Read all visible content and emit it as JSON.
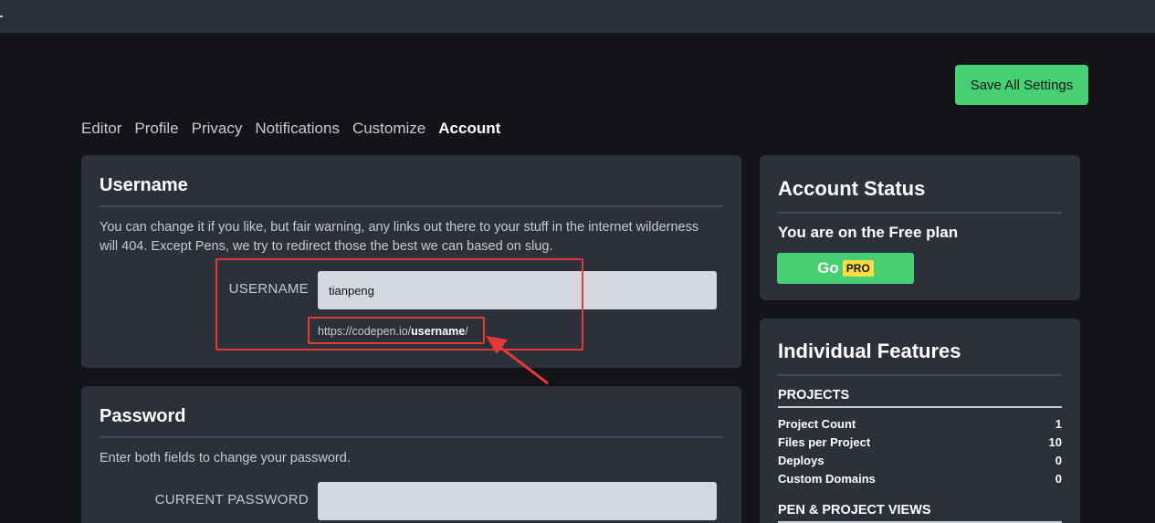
{
  "save_label": "Save All Settings",
  "tabs": [
    {
      "label": "Editor"
    },
    {
      "label": "Profile"
    },
    {
      "label": "Privacy"
    },
    {
      "label": "Notifications"
    },
    {
      "label": "Customize"
    },
    {
      "label": "Account",
      "active": true
    }
  ],
  "username_card": {
    "title": "Username",
    "description": "You can change it if you like, but fair warning, any links out there to your stuff in the internet wilderness will 404. Except Pens, we try to redirect those the best we can based on slug.",
    "label": "USERNAME",
    "value": "tianpeng",
    "url_prefix": "https://codepen.io/",
    "url_bold": "username",
    "url_suffix": "/"
  },
  "password_card": {
    "title": "Password",
    "description": "Enter both fields to change your password.",
    "current_label": "CURRENT PASSWORD",
    "current_value": ""
  },
  "account_status": {
    "title": "Account Status",
    "plan_text": "You are on the Free plan",
    "go_label": "Go",
    "pro_label": "PRO"
  },
  "features": {
    "title": "Individual Features",
    "projects_head": "PROJECTS",
    "rows": [
      {
        "label": "Project Count",
        "value": "1"
      },
      {
        "label": "Files per Project",
        "value": "10"
      },
      {
        "label": "Deploys",
        "value": "0"
      },
      {
        "label": "Custom Domains",
        "value": "0"
      }
    ],
    "views_head": "PEN & PROJECT VIEWS"
  },
  "colors": {
    "background": "#131417",
    "card": "#2c303a",
    "accent_green": "#47cf73",
    "pro_yellow": "#ffdd40",
    "annotation_red": "#e53935"
  }
}
